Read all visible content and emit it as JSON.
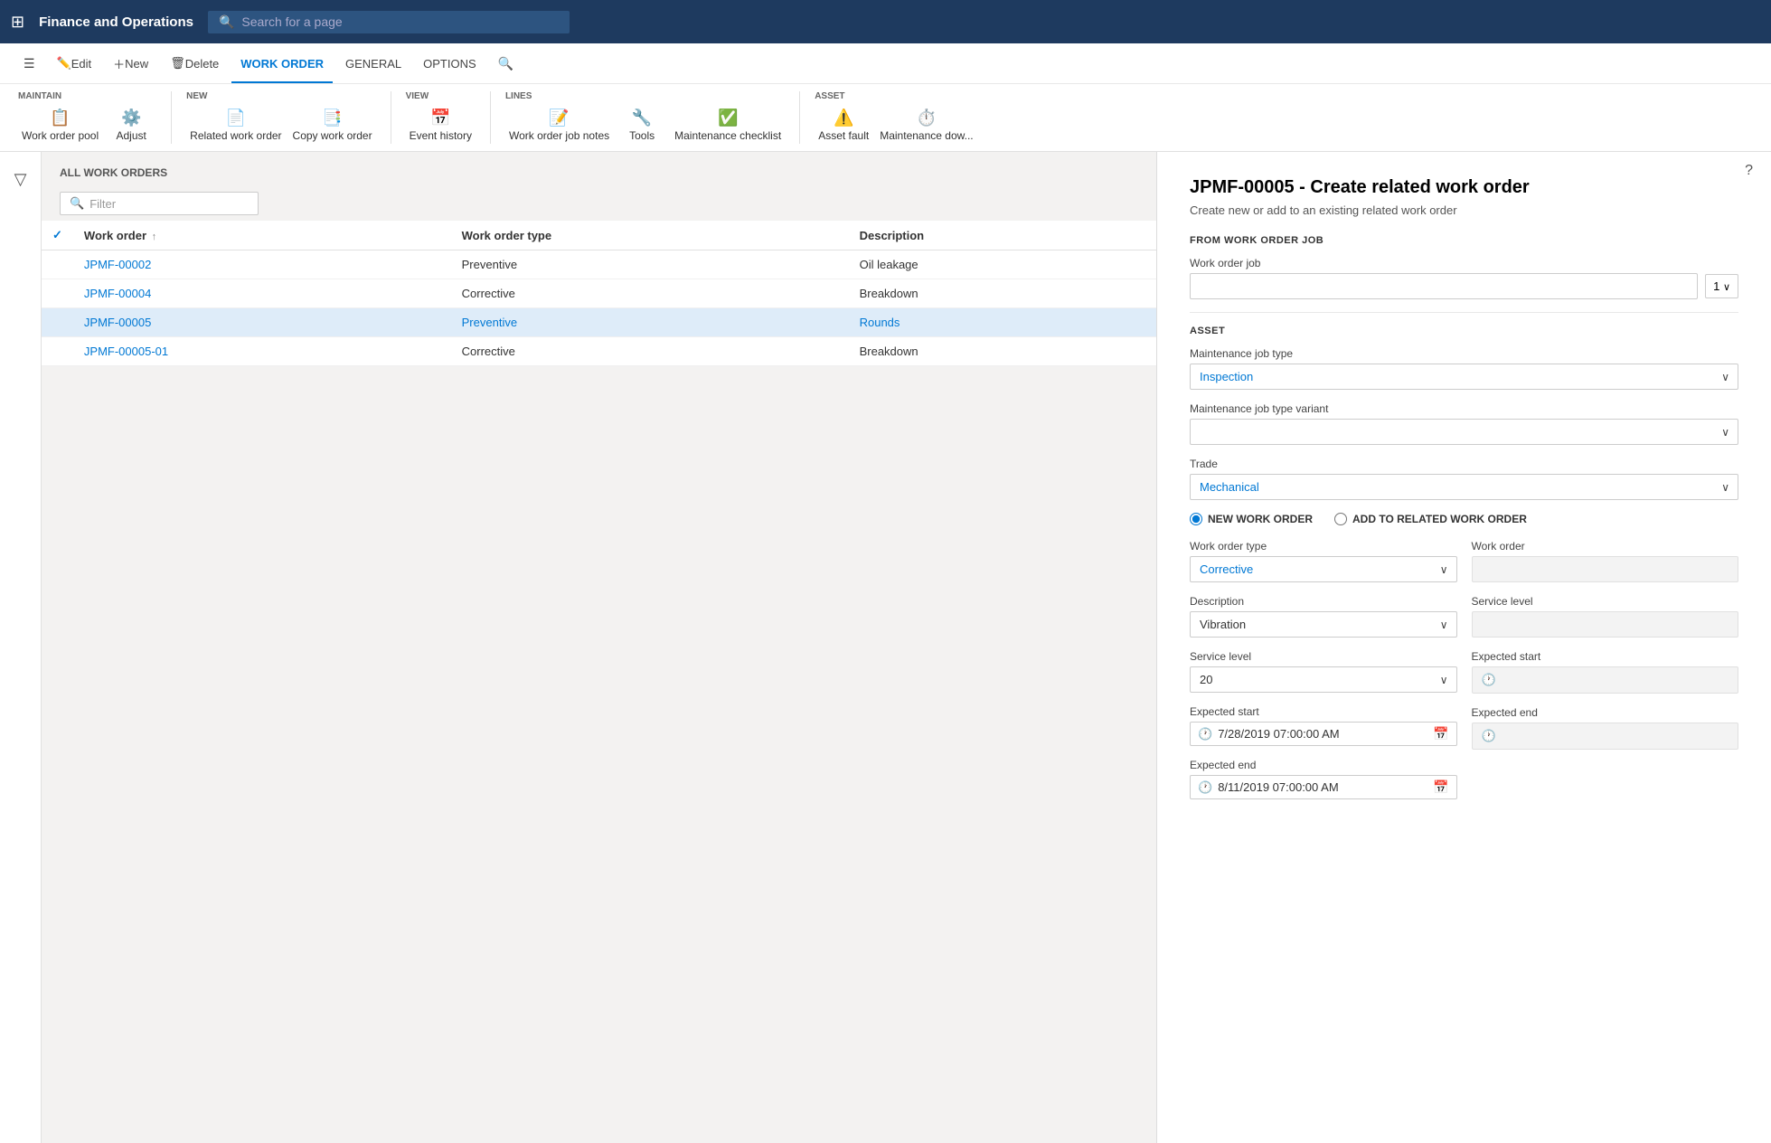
{
  "app": {
    "title": "Finance and Operations",
    "search_placeholder": "Search for a page"
  },
  "ribbon": {
    "tabs": [
      {
        "id": "edit",
        "label": "Edit",
        "icon": "✏️",
        "active": false
      },
      {
        "id": "new",
        "label": "New",
        "icon": "＋",
        "active": false
      },
      {
        "id": "delete",
        "label": "Delete",
        "icon": "🗑",
        "active": false
      },
      {
        "id": "work_order",
        "label": "WORK ORDER",
        "active": true
      },
      {
        "id": "general",
        "label": "GENERAL",
        "active": false
      },
      {
        "id": "options",
        "label": "OPTIONS",
        "active": false
      },
      {
        "id": "search",
        "label": "🔍",
        "active": false
      }
    ],
    "groups": [
      {
        "id": "maintain",
        "label": "MAINTAIN",
        "items": [
          "Work order pool",
          "Adjust"
        ]
      },
      {
        "id": "new",
        "label": "NEW",
        "items": [
          "Related work order",
          "Copy work order"
        ]
      },
      {
        "id": "view",
        "label": "VIEW",
        "items": [
          "Event history"
        ]
      },
      {
        "id": "lines",
        "label": "LINES",
        "items": [
          "Work order job notes",
          "Tools",
          "Maintenance checklist"
        ]
      },
      {
        "id": "asset",
        "label": "ASSET",
        "items": [
          "Asset fault",
          "Maintenance dow..."
        ]
      }
    ]
  },
  "list": {
    "header": "ALL WORK ORDERS",
    "filter_placeholder": "Filter",
    "columns": [
      "Work order",
      "Work order type",
      "Description"
    ],
    "rows": [
      {
        "id": "JPMF-00002",
        "type": "Preventive",
        "description": "Oil leakage",
        "selected": false
      },
      {
        "id": "JPMF-00004",
        "type": "Corrective",
        "description": "Breakdown",
        "selected": false
      },
      {
        "id": "JPMF-00005",
        "type": "Preventive",
        "description": "Rounds",
        "selected": true
      },
      {
        "id": "JPMF-00005-01",
        "type": "Corrective",
        "description": "Breakdown",
        "selected": false
      }
    ]
  },
  "dialog": {
    "title": "JPMF-00005 - Create related work order",
    "subtitle": "Create new or add to an existing related work order",
    "from_work_order_job_label": "FROM WORK ORDER JOB",
    "work_order_job_label": "Work order job",
    "work_order_job_value": "1",
    "asset_section_label": "ASSET",
    "maintenance_job_type_label": "Maintenance job type",
    "maintenance_job_type_value": "Inspection",
    "maintenance_job_type_variant_label": "Maintenance job type variant",
    "maintenance_job_type_variant_value": "",
    "trade_label": "Trade",
    "trade_value": "Mechanical",
    "new_work_order_label": "NEW WORK ORDER",
    "add_to_related_label": "ADD TO RELATED WORK ORDER",
    "work_order_type_label": "Work order type",
    "work_order_type_value": "Corrective",
    "description_label": "Description",
    "description_value": "Vibration",
    "service_level_label": "Service level",
    "service_level_value": "20",
    "expected_start_label": "Expected start",
    "expected_start_value": "7/28/2019 07:00:00 AM",
    "expected_end_label": "Expected end",
    "expected_end_value": "8/11/2019 07:00:00 AM",
    "right_work_order_label": "Work order",
    "right_work_order_value": "",
    "right_service_level_label": "Service level",
    "right_service_level_value": "",
    "right_expected_start_label": "Expected start",
    "right_expected_start_value": "",
    "right_expected_end_label": "Expected end",
    "right_expected_end_value": ""
  }
}
